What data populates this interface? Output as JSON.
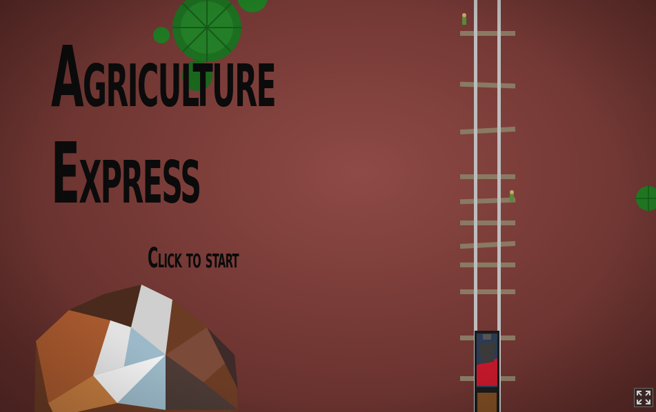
{
  "game": {
    "title_line1": "Agriculture",
    "title_line2": "Express",
    "start_prompt": "Click to start",
    "fullscreen_icon": "expand-arrows-icon"
  },
  "colors": {
    "background": "#8e4a46",
    "title_text": "#0b0b0b",
    "tree_green": "#1f7a22",
    "rail": "#bdbdbd",
    "sleeper": "#8a7a63",
    "train_red": "#c0182a"
  }
}
